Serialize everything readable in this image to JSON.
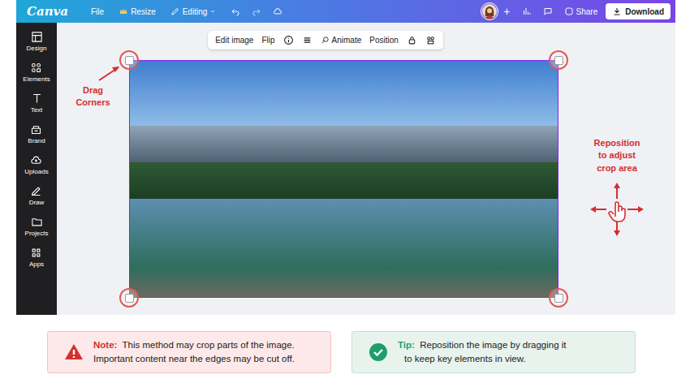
{
  "topbar": {
    "logo": "Canva",
    "menu": [
      "File",
      "Resize",
      "Editing"
    ],
    "add": "+",
    "share": "Share",
    "download": "Download"
  },
  "sidebar": {
    "items": [
      "Design",
      "Elements",
      "Text",
      "Brand",
      "Uploads",
      "Draw",
      "Projects",
      "Apps"
    ]
  },
  "toolbar": {
    "items": [
      "Edit image",
      "Flip",
      "Animate",
      "Position"
    ]
  },
  "annotations": {
    "drag": [
      "Drag",
      "Corners"
    ],
    "reposition": [
      "Reposition",
      "to adjust",
      "crop area"
    ]
  },
  "note": {
    "title": "Note:",
    "lines": [
      "This method may crop parts of the image.",
      "Important content near the edges may be cut off."
    ]
  },
  "tip": {
    "title": "Tip:",
    "lines": [
      "Reposition the image by dragging it",
      "to keep key elements in view."
    ]
  }
}
